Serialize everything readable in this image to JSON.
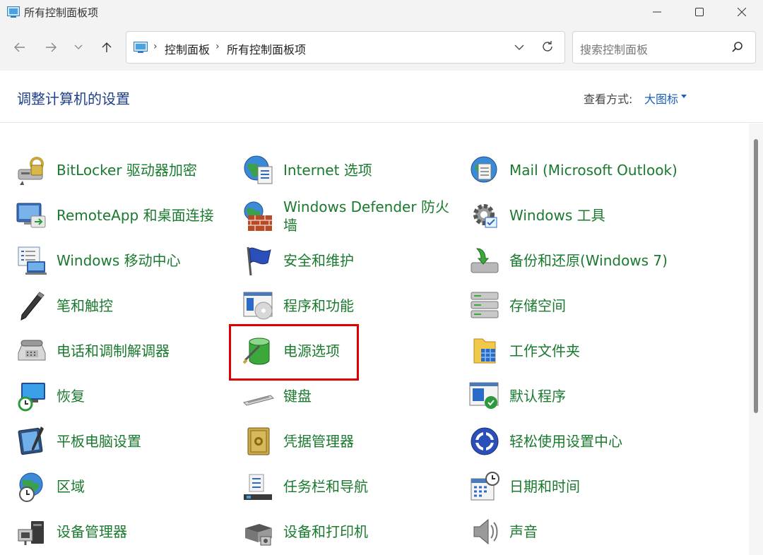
{
  "window": {
    "title": "所有控制面板项"
  },
  "address_bar": {
    "crumbs": [
      "控制面板",
      "所有控制面板项"
    ]
  },
  "search": {
    "placeholder": "搜索控制面板"
  },
  "header": {
    "title": "调整计算机的设置",
    "view_by_label": "查看方式:",
    "view_by_value": "大图标"
  },
  "items": {
    "col1": [
      {
        "label": "BitLocker 驱动器加密",
        "icon": "bitlocker-icon"
      },
      {
        "label": "RemoteApp 和桌面连接",
        "icon": "remoteapp-icon"
      },
      {
        "label": "Windows 移动中心",
        "icon": "mobility-center-icon"
      },
      {
        "label": "笔和触控",
        "icon": "pen-icon"
      },
      {
        "label": "电话和调制解调器",
        "icon": "phone-modem-icon"
      },
      {
        "label": "恢复",
        "icon": "recovery-icon"
      },
      {
        "label": "平板电脑设置",
        "icon": "tablet-icon"
      },
      {
        "label": "区域",
        "icon": "region-globe-icon"
      },
      {
        "label": "设备管理器",
        "icon": "device-manager-icon"
      }
    ],
    "col2": [
      {
        "label": "Internet 选项",
        "icon": "internet-globe-icon"
      },
      {
        "label": "Windows Defender 防火墙",
        "icon": "firewall-icon"
      },
      {
        "label": "安全和维护",
        "icon": "flag-icon"
      },
      {
        "label": "程序和功能",
        "icon": "programs-icon"
      },
      {
        "label": "电源选项",
        "icon": "battery-icon"
      },
      {
        "label": "键盘",
        "icon": "keyboard-icon"
      },
      {
        "label": "凭据管理器",
        "icon": "safe-icon"
      },
      {
        "label": "任务栏和导航",
        "icon": "taskbar-icon"
      },
      {
        "label": "设备和打印机",
        "icon": "printer-icon"
      }
    ],
    "col3": [
      {
        "label": "Mail (Microsoft Outlook)",
        "icon": "mail-icon"
      },
      {
        "label": "Windows 工具",
        "icon": "gear-icon"
      },
      {
        "label": "备份和还原(Windows 7)",
        "icon": "backup-icon"
      },
      {
        "label": "存储空间",
        "icon": "storage-icon"
      },
      {
        "label": "工作文件夹",
        "icon": "folder-icon"
      },
      {
        "label": "默认程序",
        "icon": "default-programs-icon"
      },
      {
        "label": "轻松使用设置中心",
        "icon": "accessibility-icon"
      },
      {
        "label": "日期和时间",
        "icon": "calendar-clock-icon"
      },
      {
        "label": "声音",
        "icon": "speaker-icon"
      }
    ]
  },
  "colors": {
    "link_green": "#1a7a2e",
    "title_blue": "#1e3f8c",
    "highlight_red": "#e00000"
  }
}
